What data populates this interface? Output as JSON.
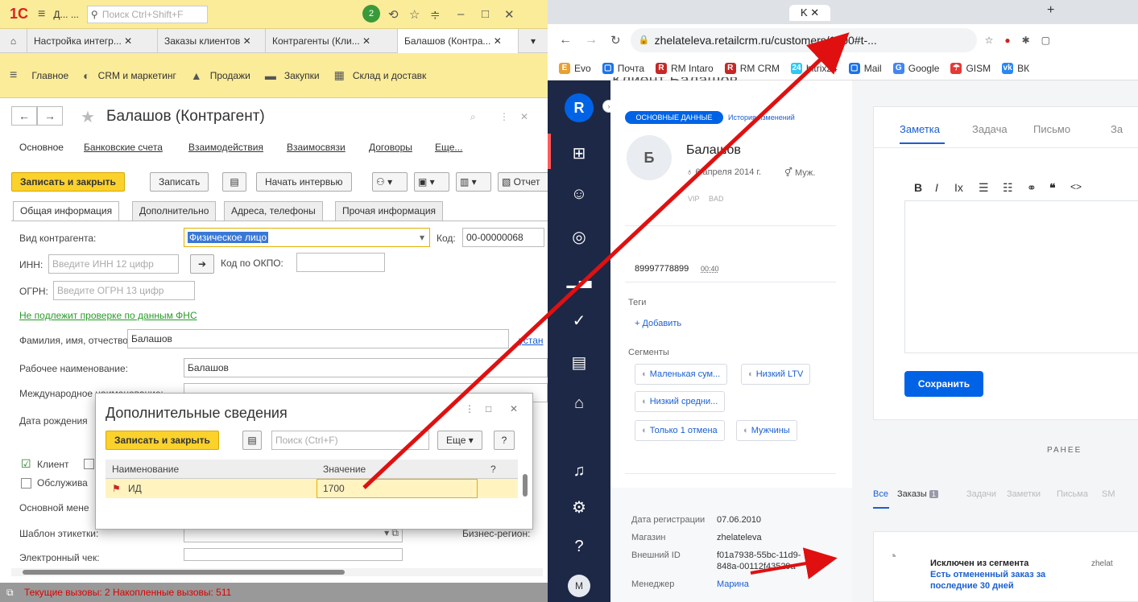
{
  "onec": {
    "logo": "1C",
    "title_short": "Д...  ...",
    "search_placeholder": "Поиск Ctrl+Shift+F",
    "notif_count": "2",
    "tabs": [
      "Настройка интегр...",
      "Заказы клиентов",
      "Контрагенты (Кли...",
      "Балашов (Контра..."
    ],
    "sections": [
      "Главное",
      "CRM и маркетинг",
      "Продажи",
      "Закупки",
      "Склад и доставк"
    ],
    "form_title": "Балашов (Контрагент)",
    "form_links": [
      "Основное",
      "Банковские счета",
      "Взаимодействия",
      "Взаимосвязи",
      "Договоры",
      "Еще..."
    ],
    "buttons": {
      "save_close": "Записать и закрыть",
      "save": "Записать",
      "interview": "Начать интервью",
      "reports": "Отчет"
    },
    "form_tabs": [
      "Общая информация",
      "Дополнительно",
      "Адреса, телефоны",
      "Прочая информация"
    ],
    "fields": {
      "type_label": "Вид контрагента:",
      "type_value": "Физическое лицо",
      "code_label": "Код:",
      "code_value": "00-00000068",
      "inn_label": "ИНН:",
      "inn_placeholder": "Введите ИНН 12 цифр",
      "okpo_label": "Код по ОКПО:",
      "ogrn_label": "ОГРН:",
      "ogrn_placeholder": "Введите ОГРН 13 цифр",
      "fns_link": "Не подлежит проверке по данным ФНС",
      "fio_label": "Фамилия, имя, отчество:",
      "fio_value": "Балашов",
      "fio_link": "устан",
      "work_name_label": "Рабочее наименование:",
      "work_name_value": "Балашов",
      "intl_name_label": "Международное наименование:",
      "birth_label": "Дата рождения",
      "client_label": "Клиент",
      "service_label": "Обслужива",
      "manager_label": "Основной мене",
      "template_label": "Шаблон этикетки:",
      "region_label": "Бизнес-регион:",
      "receipt_label": "Электронный чек:"
    },
    "status": "Текущие вызовы: 2   Накопленные вызовы: 511",
    "popup": {
      "title": "Дополнительные сведения",
      "save_close": "Записать и закрыть",
      "search_placeholder": "Поиск (Ctrl+F)",
      "more": "Еще",
      "help": "?",
      "col_name": "Наименование",
      "col_value": "Значение",
      "col_q": "?",
      "row_name": "ИД",
      "row_value": "1700"
    }
  },
  "browser": {
    "tab_active": "K",
    "url": "zhelateleva.retailcrm.ru/customers/1700#t-...",
    "bookmarks": [
      "Evo",
      "Почта",
      "RM Intaro",
      "RM CRM",
      "bitrix24",
      "Mail",
      "Google",
      "GISM",
      "ВК"
    ]
  },
  "crm": {
    "page_title": "Клиент Балашов",
    "tab_main": "ОСНОВНЫЕ ДАННЫЕ",
    "tab_history": "История изменений",
    "avatar_letter": "Б",
    "client_name": "Балашов",
    "birth": "6 апреля 2014 г.",
    "gender": "Муж.",
    "badges": [
      "VIP",
      "BAD"
    ],
    "phone": "89997778899",
    "phone_time": "00:40",
    "tags_label": "Теги",
    "add_label": "Добавить",
    "segments_label": "Сегменты",
    "segments": [
      "Маленькая сум...",
      "Низкий LTV",
      "Низкий средни...",
      "Только 1 отмена",
      "Мужчины"
    ],
    "reg_label": "Дата регистрации",
    "reg_value": "07.06.2010",
    "shop_label": "Магазин",
    "shop_value": "zhelateleva",
    "ext_label": "Внешний ID",
    "ext_value_1": "f01a7938-55bc-11d9-",
    "ext_value_2": "848a-00112f43529a",
    "mgr_label": "Менеджер",
    "mgr_value": "Марина",
    "avatar_user": "M",
    "note_tabs": [
      "Заметка",
      "Задача",
      "Письмо",
      "За"
    ],
    "save_btn": "Сохранить",
    "earlier": "РАНЕЕ",
    "filters": [
      "Все",
      "Заказы",
      "Задачи",
      "Заметки",
      "Письма",
      "SM"
    ],
    "orders_count": "1",
    "event_text": "Исключен из сегмента",
    "event_link": "Есть отмененный заказ за последние 30 дней",
    "event_user": "zhelat"
  },
  "colors": {
    "accent_1c": "#fbec9a",
    "crm_blue": "#0063e6",
    "arrow": "#e01010"
  }
}
